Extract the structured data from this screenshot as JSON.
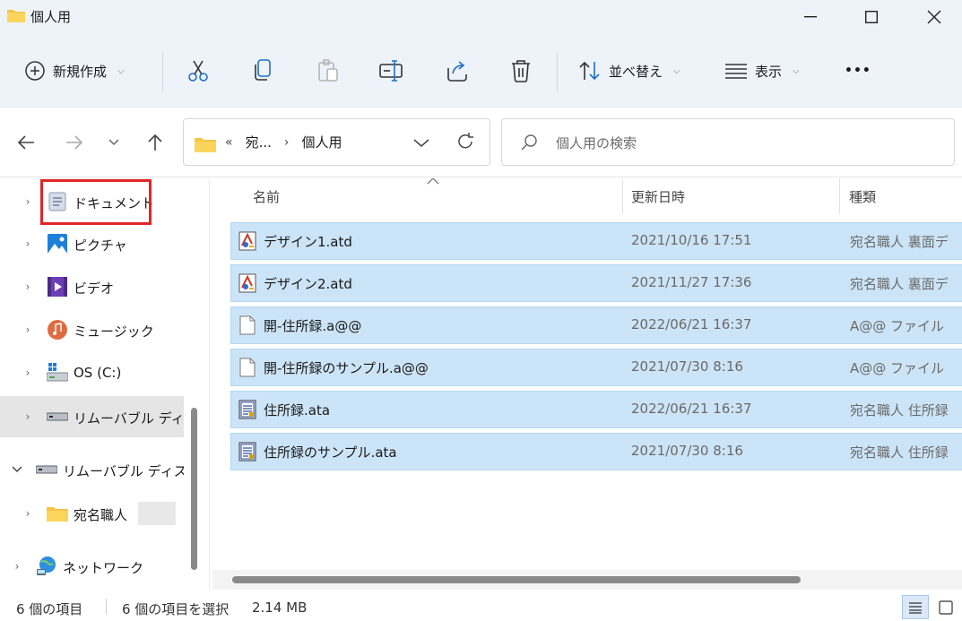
{
  "window": {
    "title": "個人用"
  },
  "toolbar": {
    "new_label": "新規作成",
    "sort_label": "並べ替え",
    "view_label": "表示",
    "more_label": "•••"
  },
  "address": {
    "overflow": "«",
    "crumbs": [
      "宛...",
      "個人用"
    ]
  },
  "search": {
    "placeholder": "個人用の検索"
  },
  "nav": {
    "items": [
      {
        "label": "ドキュメント",
        "icon": "documents-icon"
      },
      {
        "label": "ピクチャ",
        "icon": "pictures-icon"
      },
      {
        "label": "ビデオ",
        "icon": "videos-icon"
      },
      {
        "label": "ミュージック",
        "icon": "music-icon"
      },
      {
        "label": "OS (C:)",
        "icon": "drive-icon"
      },
      {
        "label": "リムーバブル ディスク",
        "icon": "removable-disk-icon"
      },
      {
        "label": "リムーバブル ディスク",
        "icon": "removable-disk-icon"
      },
      {
        "label": "宛名職人",
        "icon": "folder-icon"
      },
      {
        "label": "ネットワーク",
        "icon": "network-icon"
      }
    ]
  },
  "columns": {
    "name": "名前",
    "modified": "更新日時",
    "type": "種類"
  },
  "files": [
    {
      "name": "デザイン1.atd",
      "modified": "2021/10/16 17:51",
      "type": "宛名職人 裏面デ",
      "icon": "atd-file-icon"
    },
    {
      "name": "デザイン2.atd",
      "modified": "2021/11/27 17:36",
      "type": "宛名職人 裏面デ",
      "icon": "atd-file-icon"
    },
    {
      "name": "開-住所録.a@@",
      "modified": "2022/06/21 16:37",
      "type": "A@@ ファイル",
      "icon": "blank-file-icon"
    },
    {
      "name": "開-住所録のサンプル.a@@",
      "modified": "2021/07/30 8:16",
      "type": "A@@ ファイル",
      "icon": "blank-file-icon"
    },
    {
      "name": "住所録.ata",
      "modified": "2022/06/21 16:37",
      "type": "宛名職人 住所録",
      "icon": "ata-file-icon"
    },
    {
      "name": "住所録のサンプル.ata",
      "modified": "2021/07/30 8:16",
      "type": "宛名職人 住所録",
      "icon": "ata-file-icon"
    }
  ],
  "status": {
    "count": "6 個の項目",
    "selection": "6 個の項目を選択",
    "size": "2.14 MB"
  },
  "colors": {
    "selection": "#cce4f7",
    "highlight_border": "#e0262a",
    "chrome": "#eef3fa"
  }
}
